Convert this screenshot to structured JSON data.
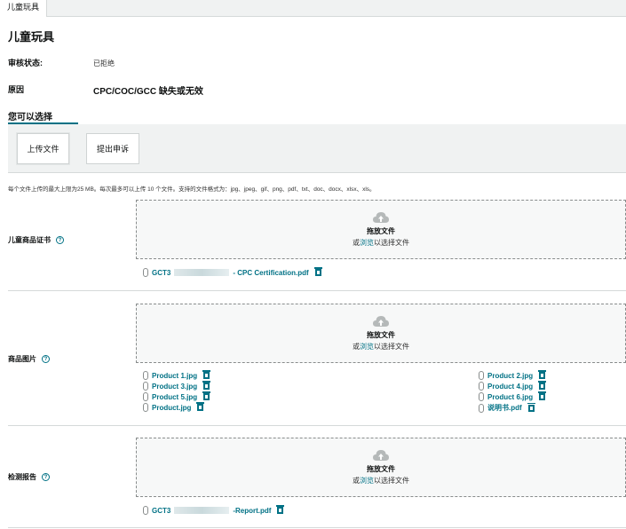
{
  "tab": {
    "label": "儿童玩具"
  },
  "page_title": "儿童玩具",
  "status": {
    "label": "审核状态:",
    "value": "已拒绝"
  },
  "reason": {
    "label": "原因",
    "value": "CPC/COC/GCC 缺失或无效"
  },
  "options": {
    "heading": "您可以选择",
    "upload_button": "上传文件",
    "appeal_button": "提出申诉"
  },
  "upload_note": "每个文件上传的最大上限为25 MB。每次最多可以上传 10 个文件。支持的文件格式为：jpg、jpeg、gif、png、pdf、txt、doc、docx、xlsx、xls。",
  "dropzone": {
    "title": "拖放文件",
    "sub_prefix": "或",
    "browse": "浏览",
    "sub_suffix": "以选择文件"
  },
  "sections": {
    "certificate": {
      "label": "儿童商品证书",
      "files": [
        {
          "prefix": "GCT3",
          "suffix": "- CPC Certification.pdf"
        }
      ]
    },
    "images": {
      "label": "商品图片",
      "files": [
        "Product 1.jpg",
        "Product 2.jpg",
        "Product 3.jpg",
        "Product 4.jpg",
        "Product 5.jpg",
        "Product 6.jpg",
        "Product.jpg",
        "说明书.pdf"
      ]
    },
    "report": {
      "label": "检测报告",
      "files": [
        {
          "prefix": "GCT3",
          "suffix": "-Report.pdf"
        }
      ]
    }
  },
  "colors": {
    "link": "#007185",
    "bar": "#f0f2f2"
  }
}
